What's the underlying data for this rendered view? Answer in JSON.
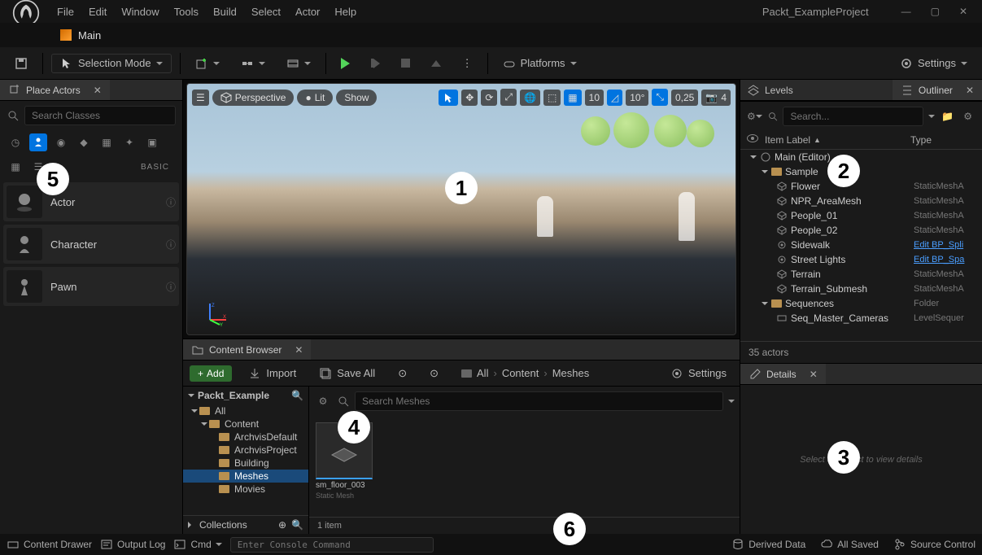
{
  "project_name": "Packt_ExampleProject",
  "menubar": [
    "File",
    "Edit",
    "Window",
    "Tools",
    "Build",
    "Select",
    "Actor",
    "Help"
  ],
  "main_tab": "Main",
  "toolbar": {
    "selection_mode": "Selection Mode",
    "platforms": "Platforms",
    "settings": "Settings"
  },
  "place_actors": {
    "title": "Place Actors",
    "search_placeholder": "Search Classes",
    "category": "BASIC",
    "items": [
      "Actor",
      "Character",
      "Pawn"
    ]
  },
  "viewport": {
    "menu_items": [
      "Perspective",
      "Lit",
      "Show"
    ],
    "snap_grid": "10",
    "snap_angle": "10°",
    "snap_scale": "0,25",
    "cam_speed": "4"
  },
  "levels_title": "Levels",
  "outliner": {
    "title": "Outliner",
    "search_placeholder": "Search...",
    "col_label": "Item Label",
    "col_type": "Type",
    "root": "Main (Editor)",
    "sample_folder": "Sample",
    "items": [
      {
        "label": "Flower",
        "type": "StaticMeshA"
      },
      {
        "label": "NPR_AreaMesh",
        "type": "StaticMeshA"
      },
      {
        "label": "People_01",
        "type": "StaticMeshA"
      },
      {
        "label": "People_02",
        "type": "StaticMeshA"
      },
      {
        "label": "Sidewalk",
        "type": "Edit BP_Spli",
        "link": true,
        "alticon": true
      },
      {
        "label": "Street Lights",
        "type": "Edit BP_Spa",
        "link": true,
        "alticon": true
      },
      {
        "label": "Terrain",
        "type": "StaticMeshA"
      },
      {
        "label": "Terrain_Submesh",
        "type": "StaticMeshA"
      }
    ],
    "sequences_folder": "Sequences",
    "sequences_type": "Folder",
    "seq_item": {
      "label": "Seq_Master_Cameras",
      "type": "LevelSequer"
    },
    "footer": "35 actors"
  },
  "details": {
    "title": "Details",
    "empty_msg": "Select an object to view details"
  },
  "content_browser": {
    "title": "Content Browser",
    "add": "Add",
    "import": "Import",
    "save_all": "Save All",
    "breadcrumb": [
      "All",
      "Content",
      "Meshes"
    ],
    "settings": "Settings",
    "project_root": "Packt_Example",
    "tree": [
      {
        "label": "All",
        "depth": 0,
        "expanded": true
      },
      {
        "label": "Content",
        "depth": 1,
        "expanded": true
      },
      {
        "label": "ArchvisDefault",
        "depth": 2
      },
      {
        "label": "ArchvisProject",
        "depth": 2
      },
      {
        "label": "Building",
        "depth": 2
      },
      {
        "label": "Meshes",
        "depth": 2,
        "selected": true
      },
      {
        "label": "Movies",
        "depth": 2
      }
    ],
    "collections": "Collections",
    "search_placeholder": "Search Meshes",
    "asset": {
      "name": "sm_floor_003",
      "type": "Static Mesh"
    },
    "footer": "1 item"
  },
  "statusbar": {
    "content_drawer": "Content Drawer",
    "output_log": "Output Log",
    "cmd": "Cmd",
    "cmd_placeholder": "Enter Console Command",
    "derived": "Derived Data",
    "saved": "All Saved",
    "source": "Source Control"
  },
  "badges": [
    "1",
    "2",
    "3",
    "4",
    "5",
    "6"
  ]
}
